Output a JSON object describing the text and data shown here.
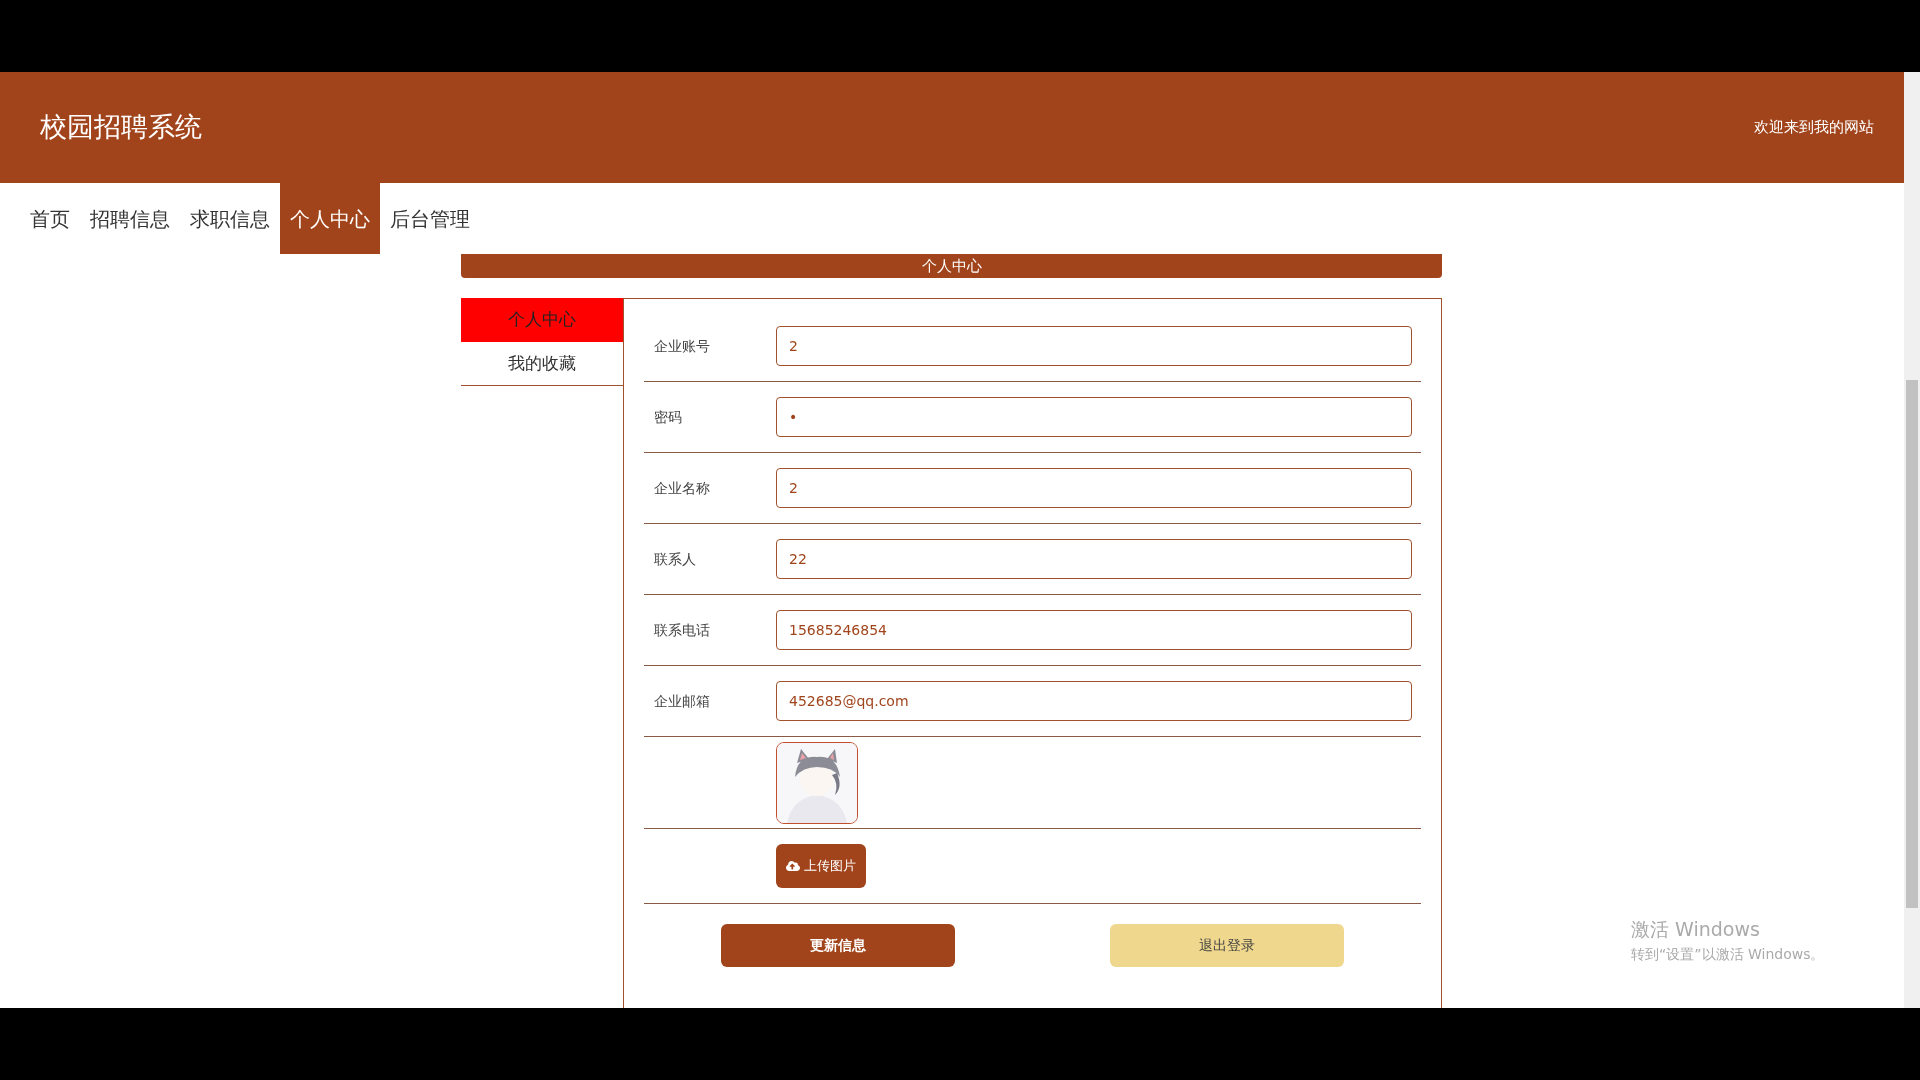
{
  "site": {
    "title": "校园招聘系统",
    "welcome": "欢迎来到我的网站"
  },
  "nav": [
    {
      "label": "首页",
      "selected": false
    },
    {
      "label": "招聘信息",
      "selected": false
    },
    {
      "label": "求职信息",
      "selected": false
    },
    {
      "label": "个人中心",
      "selected": true
    },
    {
      "label": "后台管理",
      "selected": false
    }
  ],
  "section_title": "个人中心",
  "side_menu": [
    {
      "label": "个人中心",
      "selected": true
    },
    {
      "label": "我的收藏",
      "selected": false
    }
  ],
  "form": {
    "fields": [
      {
        "label": "企业账号",
        "value": "2"
      },
      {
        "label": "密码",
        "value": "•"
      },
      {
        "label": "企业名称",
        "value": "2"
      },
      {
        "label": "联系人",
        "value": "22"
      },
      {
        "label": "联系电话",
        "value": "15685246854"
      },
      {
        "label": "企业邮箱",
        "value": "452685@qq.com"
      }
    ],
    "upload_button": "上传图片"
  },
  "actions": [
    {
      "label": "更新信息",
      "kind": "primary"
    },
    {
      "label": "退出登录",
      "kind": "secondary"
    }
  ],
  "os_notice": {
    "title": "激活 Windows",
    "message": "转到“设置”以激活 Windows。"
  }
}
